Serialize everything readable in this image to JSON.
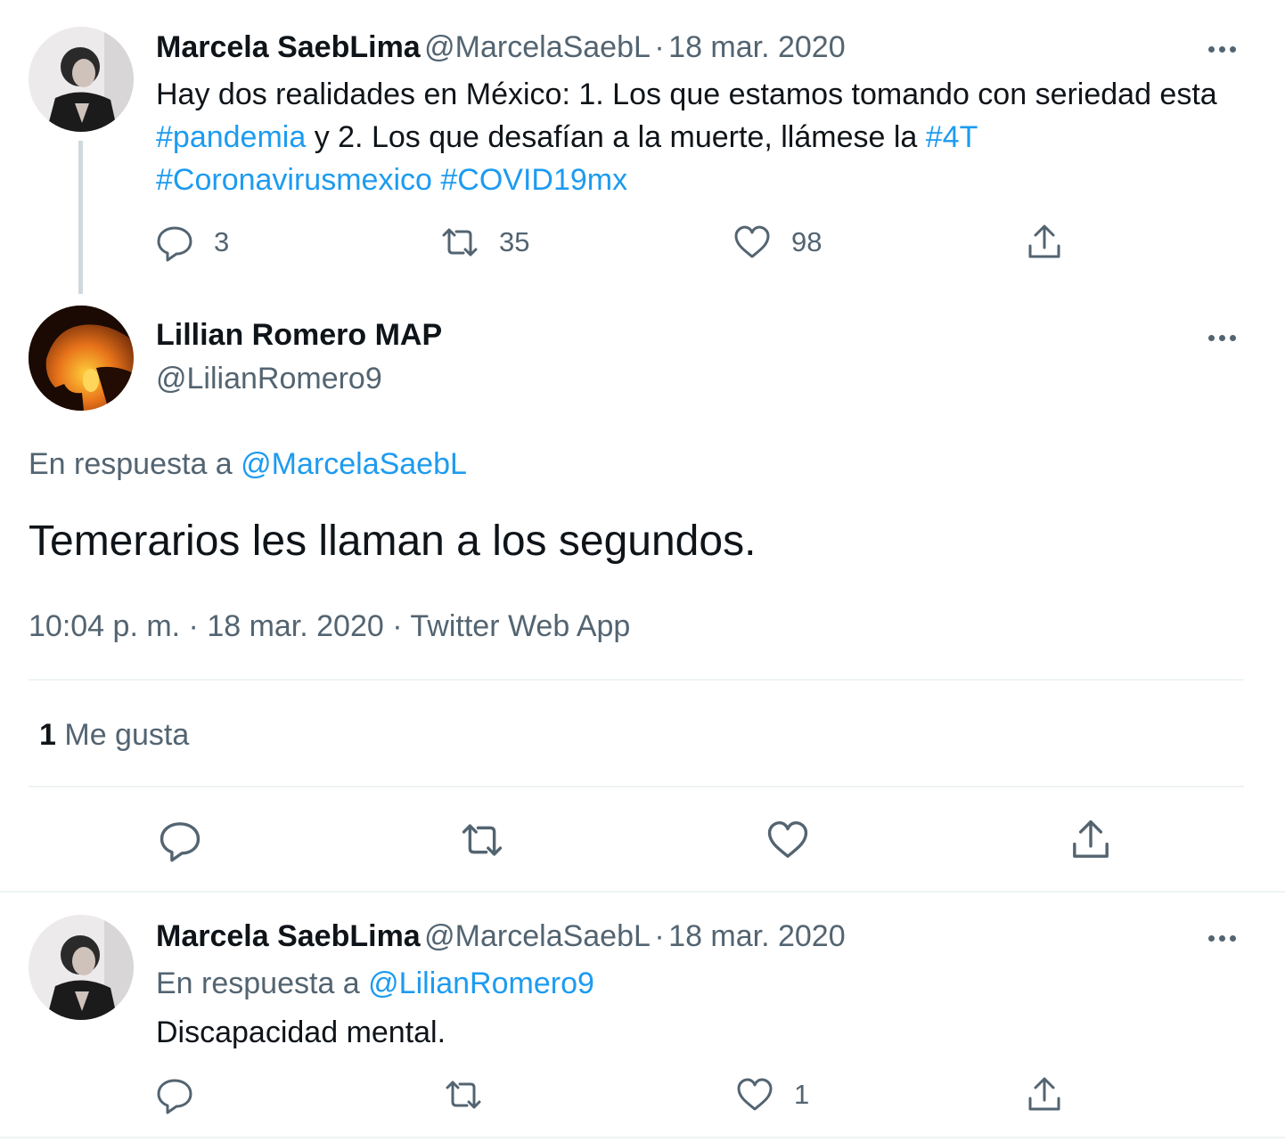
{
  "tweet1": {
    "name": "Marcela SaebLima",
    "handle": "@MarcelaSaebL",
    "separator": "·",
    "date": "18 mar. 2020",
    "text_parts": {
      "p1": "Hay dos realidades en México: 1. Los que estamos tomando con seriedad esta ",
      "tag1": "#pandemia",
      "p2": " y 2. Los que desafían a la muerte, llámese la ",
      "tag2": "#4T",
      "tag3": "#Coronavirusmexico",
      "tag4": "#COVID19mx"
    },
    "replies": "3",
    "retweets": "35",
    "likes": "98"
  },
  "tweet2": {
    "name": "Lillian Romero MAP",
    "handle": "@LilianRomero9",
    "reply_prefix": "En respuesta a",
    "reply_to": "@MarcelaSaebL",
    "text": "Temerarios les llaman a los segundos.",
    "timestamp": "10:04 p. m. · 18 mar. 2020 · Twitter Web App",
    "likes_count": "1",
    "likes_label": "Me gusta"
  },
  "tweet3": {
    "name": "Marcela SaebLima",
    "handle": "@MarcelaSaebL",
    "separator": "·",
    "date": "18 mar. 2020",
    "reply_prefix": "En respuesta a",
    "reply_to": "@LilianRomero9",
    "text": "Discapacidad mental.",
    "likes": "1"
  },
  "icons": [
    "reply-icon",
    "retweet-icon",
    "like-icon",
    "share-icon",
    "more-icon"
  ],
  "colors": {
    "link": "#1d9bf0",
    "muted": "#536471",
    "text": "#0f1419",
    "thread_line": "#cfd9de"
  }
}
